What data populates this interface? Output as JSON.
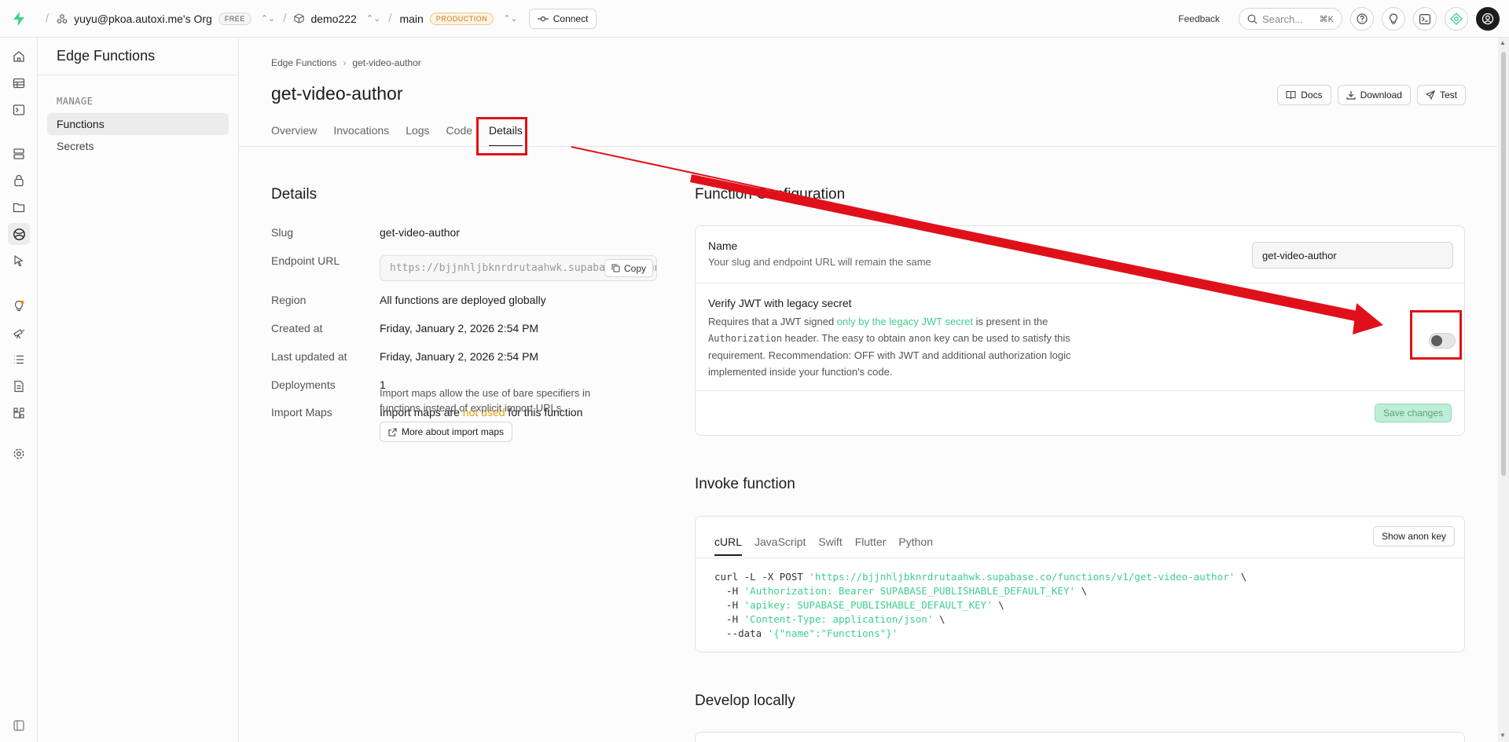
{
  "topbar": {
    "org_name": "yuyu@pkoa.autoxi.me's Org",
    "org_plan": "FREE",
    "project": "demo222",
    "branch": "main",
    "branch_badge": "PRODUCTION",
    "connect_label": "Connect",
    "feedback_label": "Feedback",
    "search_placeholder": "Search...",
    "search_shortcut": "⌘K"
  },
  "sidebar": {
    "title": "Edge Functions",
    "section": "MANAGE",
    "items": [
      {
        "label": "Functions",
        "active": true
      },
      {
        "label": "Secrets",
        "active": false
      }
    ]
  },
  "page": {
    "breadcrumb": [
      "Edge Functions",
      "get-video-author"
    ],
    "title": "get-video-author",
    "actions": {
      "docs": "Docs",
      "download": "Download",
      "test": "Test"
    },
    "tabs": [
      {
        "label": "Overview"
      },
      {
        "label": "Invocations"
      },
      {
        "label": "Logs"
      },
      {
        "label": "Code"
      },
      {
        "label": "Details",
        "active": true
      }
    ]
  },
  "details": {
    "heading": "Details",
    "slug_label": "Slug",
    "slug_value": "get-video-author",
    "endpoint_label": "Endpoint URL",
    "endpoint_value": "https://bjjnhljbknrdrutaahwk.supabase.co/functions/v1/get-video-author",
    "copy_label": "Copy",
    "region_label": "Region",
    "region_value": "All functions are deployed globally",
    "created_label": "Created at",
    "created_value": "Friday, January 2, 2026 2:54 PM",
    "updated_label": "Last updated at",
    "updated_value": "Friday, January 2, 2026 2:54 PM",
    "deployments_label": "Deployments",
    "deployments_value": "1",
    "import_label": "Import Maps",
    "import_pre": "Import maps are ",
    "import_highlight": "not used",
    "import_post": " for this function",
    "import_desc": "Import maps allow the use of bare specifiers in functions instead of explicit import URLs",
    "import_btn": "More about import maps"
  },
  "config": {
    "heading": "Function Configuration",
    "name_label": "Name",
    "name_desc": "Your slug and endpoint URL will remain the same",
    "name_value": "get-video-author",
    "jwt_label": "Verify JWT with legacy secret",
    "jwt_desc_1": "Requires that a JWT signed ",
    "jwt_desc_link": "only by the legacy JWT secret",
    "jwt_desc_2": " is present in the",
    "jwt_desc_code": "Authorization",
    "jwt_desc_3": " header. The easy to obtain ",
    "jwt_desc_code2": "anon",
    "jwt_desc_4": " key can be used to satisfy this requirement. Recommendation: OFF with JWT and additional authorization logic implemented inside your function's code.",
    "jwt_enabled": false,
    "save_label": "Save changes"
  },
  "invoke": {
    "heading": "Invoke function",
    "tabs": [
      "cURL",
      "JavaScript",
      "Swift",
      "Flutter",
      "Python"
    ],
    "active_tab": "cURL",
    "anon_btn": "Show anon key",
    "code_lines": [
      {
        "pre": "curl -L -X POST ",
        "str": "'https://bjjnhljbknrdrutaahwk.supabase.co/functions/v1/get-video-author'",
        "post": " \\"
      },
      {
        "pre": "  -H ",
        "str": "'Authorization: Bearer SUPABASE_PUBLISHABLE_DEFAULT_KEY'",
        "post": " \\"
      },
      {
        "pre": "  -H ",
        "str": "'apikey: SUPABASE_PUBLISHABLE_DEFAULT_KEY'",
        "post": " \\"
      },
      {
        "pre": "  -H ",
        "str": "'Content-Type: application/json'",
        "post": " \\"
      },
      {
        "pre": "  --data ",
        "str": "'{\"name\":\"Functions\"}'",
        "post": ""
      }
    ]
  },
  "develop": {
    "heading": "Develop locally"
  },
  "colors": {
    "accent_green": "#3ecf8e",
    "annotation_red": "#e0101a",
    "warning_amber": "#e3a008"
  }
}
